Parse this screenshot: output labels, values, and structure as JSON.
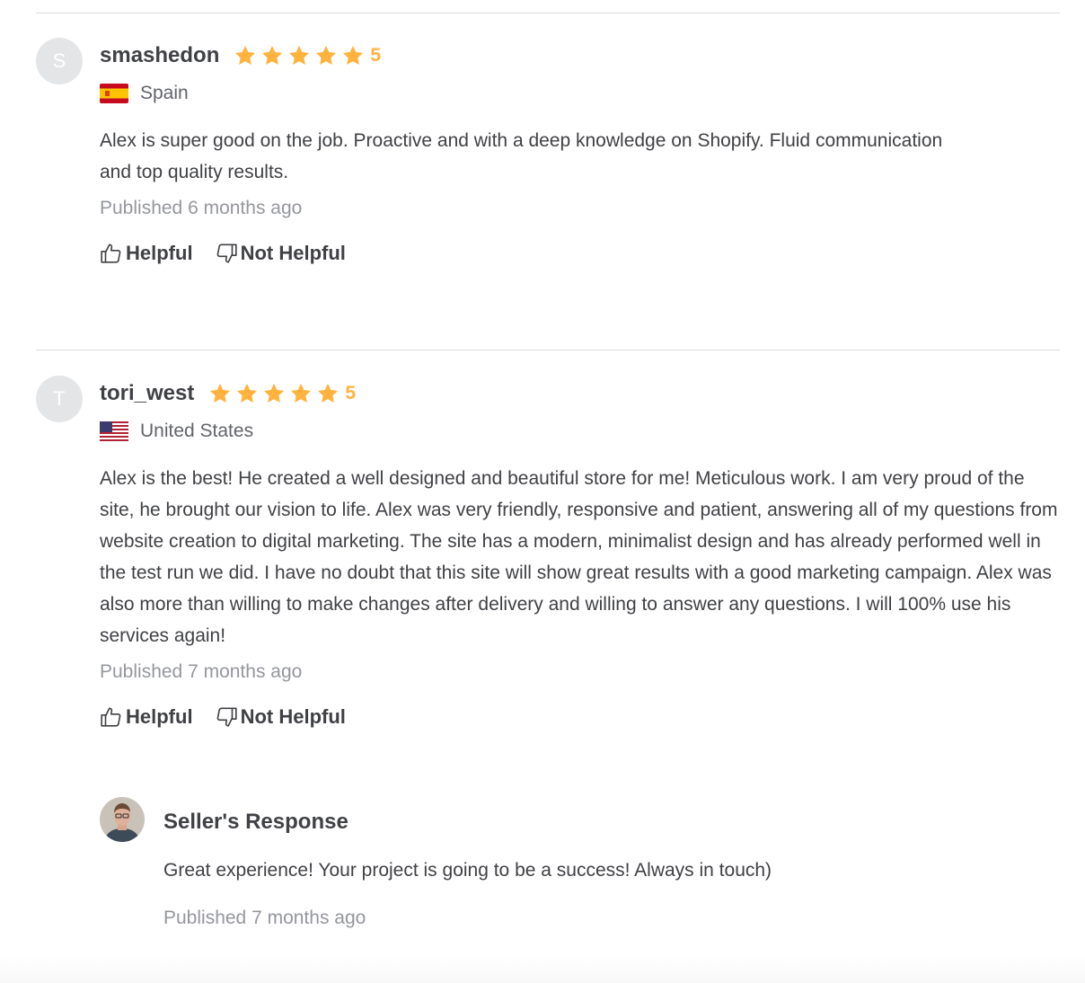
{
  "reviews": [
    {
      "avatar_letter": "S",
      "username": "smashedon",
      "rating": "5",
      "stars": 5,
      "country": "Spain",
      "flag": "spain-flag",
      "text": "Alex is super good on the job. Proactive and with a deep knowledge on Shopify. Fluid communication and top quality results.",
      "published": "Published 6 months ago",
      "helpful_label": "Helpful",
      "not_helpful_label": "Not Helpful"
    },
    {
      "avatar_letter": "T",
      "username": "tori_west",
      "rating": "5",
      "stars": 5,
      "country": "United States",
      "flag": "us-flag",
      "text": "Alex is the best! He created a well designed and beautiful store for me! Meticulous work. I am very proud of the site, he brought our vision to life. Alex was very friendly, responsive and patient, answering all of my questions from website creation to digital marketing. The site has a modern, minimalist design and has already performed well in the test run we did. I have no doubt that this site will show great results with a good marketing campaign. Alex was also more than willing to make changes after delivery and willing to answer any questions. I will 100% use his services again!",
      "published": "Published 7 months ago",
      "helpful_label": "Helpful",
      "not_helpful_label": "Not Helpful"
    }
  ],
  "seller_response": {
    "title": "Seller's Response",
    "text": "Great experience! Your project is going to be a success! Always in touch)",
    "published": "Published 7 months ago"
  },
  "colors": {
    "star": "#ffb33e",
    "text": "#404145",
    "muted": "#95979d",
    "divider": "#dadbdd"
  },
  "icons": [
    "star-icon",
    "thumbs-up-icon",
    "thumbs-down-icon"
  ]
}
